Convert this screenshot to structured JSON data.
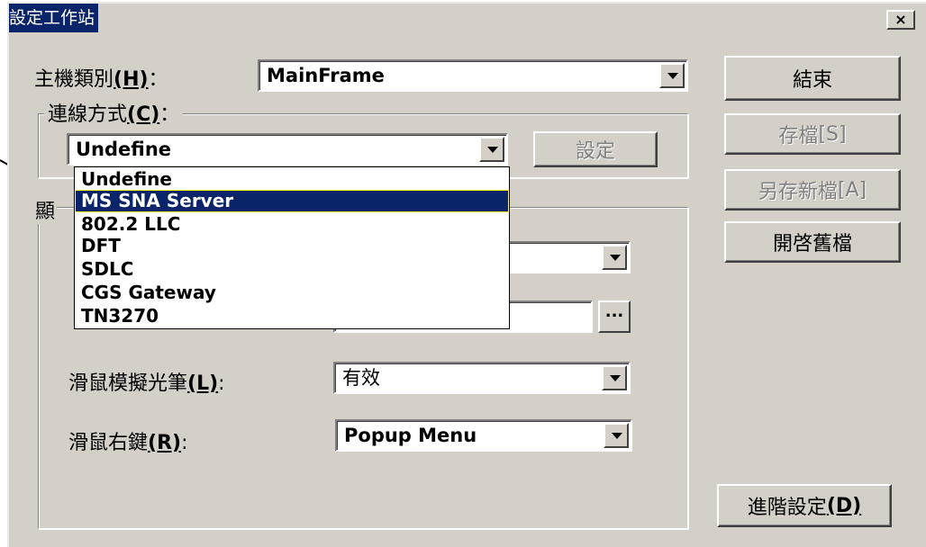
{
  "window": {
    "title": "設定工作站",
    "close_label": "×"
  },
  "host_type": {
    "label": "主機類別",
    "accel": "(H)",
    "colon": "：",
    "value": "MainFrame"
  },
  "connection": {
    "label": "連線方式",
    "accel": "(C)",
    "colon": "：",
    "value": "Undefine",
    "settings_button": "設定",
    "options": [
      "Undefine",
      "MS SNA Server",
      "802.2 LLC",
      "DFT",
      "SDLC",
      "CGS Gateway",
      "TN3270"
    ],
    "highlighted_option": "MS SNA Server"
  },
  "display_group": {
    "legend_fragment": "顯"
  },
  "light_pen": {
    "label": "滑鼠模擬光筆",
    "accel": "(L)",
    "colon": ":",
    "value": "有效"
  },
  "right_click": {
    "label": "滑鼠右鍵",
    "accel": "(R)",
    "colon": ":",
    "value": "Popup Menu"
  },
  "browse_button": "...",
  "buttons": {
    "close": "結束",
    "save": "存檔",
    "save_accel": "[S]",
    "save_as": "另存新檔",
    "save_as_accel": "[A]",
    "open": "開啓舊檔",
    "advanced": "進階設定",
    "advanced_accel": "(D)"
  },
  "colors": {
    "face": "#d4d0c8",
    "selection": "#0a246a",
    "disabled_text": "#808080"
  }
}
